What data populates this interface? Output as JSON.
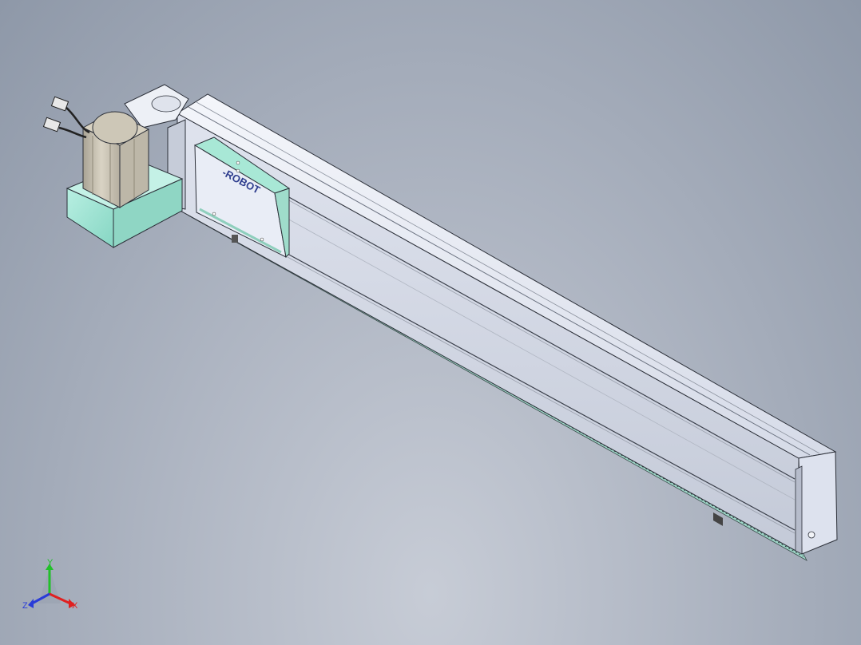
{
  "model": {
    "logo_text": "ROBOT",
    "logo_prefix": "-"
  },
  "triad": {
    "x_label": "X",
    "y_label": "Y",
    "z_label": "Z",
    "x_color": "#e02020",
    "y_color": "#22c02a",
    "z_color": "#2a3cd8"
  },
  "colors": {
    "teal_part": "#9fe3d2",
    "rail_body": "#e4e8f3",
    "motor_body": "#c9c3b3"
  }
}
